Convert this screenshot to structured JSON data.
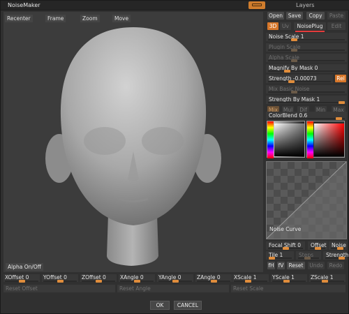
{
  "window": {
    "title": "NoiseMaker",
    "layers_label": "Layers"
  },
  "viewport": {
    "buttons": [
      "Recenter",
      "Frame",
      "Zoom",
      "Move"
    ],
    "alpha_onoff": "Alpha On/Off"
  },
  "panel": {
    "top_buttons": [
      "Open",
      "Save",
      "Copy",
      "Paste"
    ],
    "mode_buttons": [
      "3D",
      "Uv",
      "NoisePlug",
      "Edit"
    ],
    "sliders": {
      "noise_scale": "Noise Scale 1",
      "plugin_scale": "Plugin Scale",
      "alpha_scale": "Alpha Scale",
      "magnify_by_mask": "Magnify By Mask 0",
      "strength": "Strength -0.00073",
      "rel": "Rel",
      "mix_basic_noise": "Mix Basic Noise",
      "strength_by_mask": "Strength By Mask 1"
    },
    "blend_modes": [
      "Mix",
      "Mul",
      "Dif",
      "Min",
      "Max"
    ],
    "color_blend": "ColorBlend 0.6",
    "noise_curve": "Noise Curve",
    "focal_shift": "Focal Shift 0",
    "offset": "Offset",
    "noise": "Noise",
    "tile": "Tile 1",
    "steps": "Steps",
    "strength2": "Strength",
    "curve_buttons": [
      "fH",
      "fV",
      "Reset",
      "Undo",
      "Redo"
    ]
  },
  "bottom": {
    "sliders": [
      "XOffset 0",
      "YOffset 0",
      "ZOffset 0",
      "XAngle 0",
      "YAngle 0",
      "ZAngle 0",
      "XScale 1",
      "YScale 1",
      "ZScale 1"
    ],
    "resets": [
      "Reset Offset",
      "Reset Angle",
      "Reset Scale"
    ],
    "ok": "OK",
    "cancel": "CANCEL"
  },
  "colors": {
    "accent": "#d7772a",
    "panel": "#303030"
  }
}
